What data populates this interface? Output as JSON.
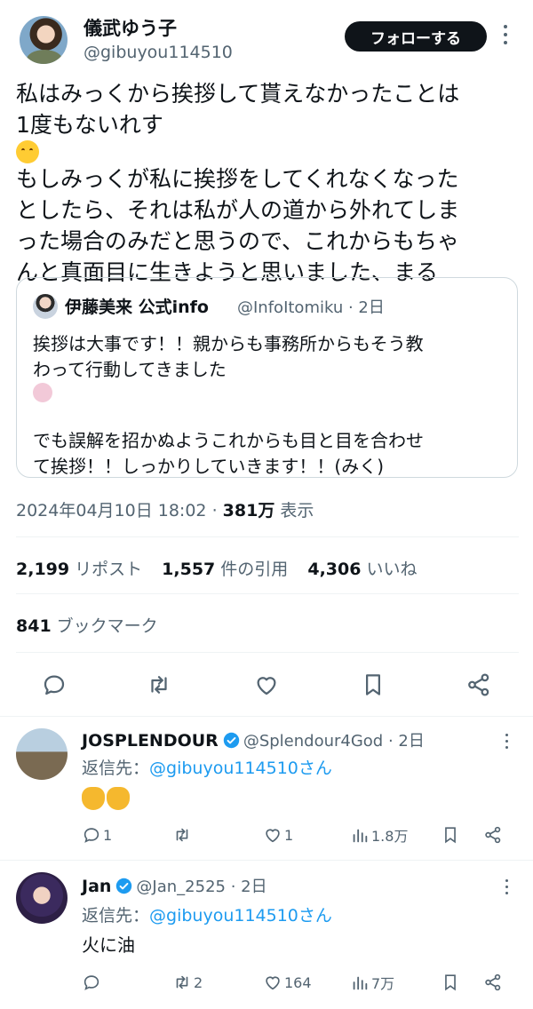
{
  "tweet": {
    "author": {
      "display_name": "儀武ゆう子",
      "handle": "@gibuyou114510"
    },
    "follow_label": "フォローする",
    "text_lines": [
      "私はみっくから挨拶して貰えなかったことは",
      "1度もないれす",
      "もしみっくが私に挨拶をしてくれなくなった",
      "としたら、それは私が人の道から外れてしま",
      "った場合のみだと思うので、これからもちゃ",
      "んと真面目に生きようと思いました、まる"
    ],
    "emoji": "face-savoring-food-emoji",
    "quote": {
      "name": "伊藤美来 公式info",
      "handle_time": "@InfoItomiku · 2日",
      "text_lines": [
        "挨拶は大事です！！親からも事務所からもそう教",
        "わって行動してきました",
        "",
        "でも誤解を招かぬようこれからも目と目を合わせ",
        "て挨拶！！しっかりしていきます！！(みく)"
      ]
    },
    "timestamp": "2024年04月10日 18:02",
    "views_count": "381万",
    "views_label": "表示",
    "stats": {
      "reposts": {
        "count": "2,199",
        "label": "リポスト"
      },
      "quotes": {
        "count": "1,557",
        "label": "件の引用"
      },
      "likes": {
        "count": "4,306",
        "label": "いいね"
      },
      "bookmarks": {
        "count": "841",
        "label": "ブックマーク"
      }
    }
  },
  "replies": [
    {
      "name": "JOSPLENDOUR",
      "handle_time": "@Splendour4God · 2日",
      "reply_to_prefix": "返信先：",
      "reply_to_handle": "@gibuyou114510さん",
      "body": "",
      "body_emoji": "clapping-hands-emoji",
      "actions": {
        "replies": "1",
        "reposts": "",
        "likes": "1",
        "views": "1.8万"
      }
    },
    {
      "name": "Jan",
      "handle_time": "@Jan_2525 · 2日",
      "reply_to_prefix": "返信先：",
      "reply_to_handle": "@gibuyou114510さん",
      "body": "火に油",
      "actions": {
        "replies": "",
        "reposts": "2",
        "likes": "164",
        "views": "7万"
      }
    }
  ],
  "colors": {
    "accent": "#1d9bf0",
    "text": "#0f1419",
    "muted": "#536471",
    "border": "#cfd9de"
  }
}
